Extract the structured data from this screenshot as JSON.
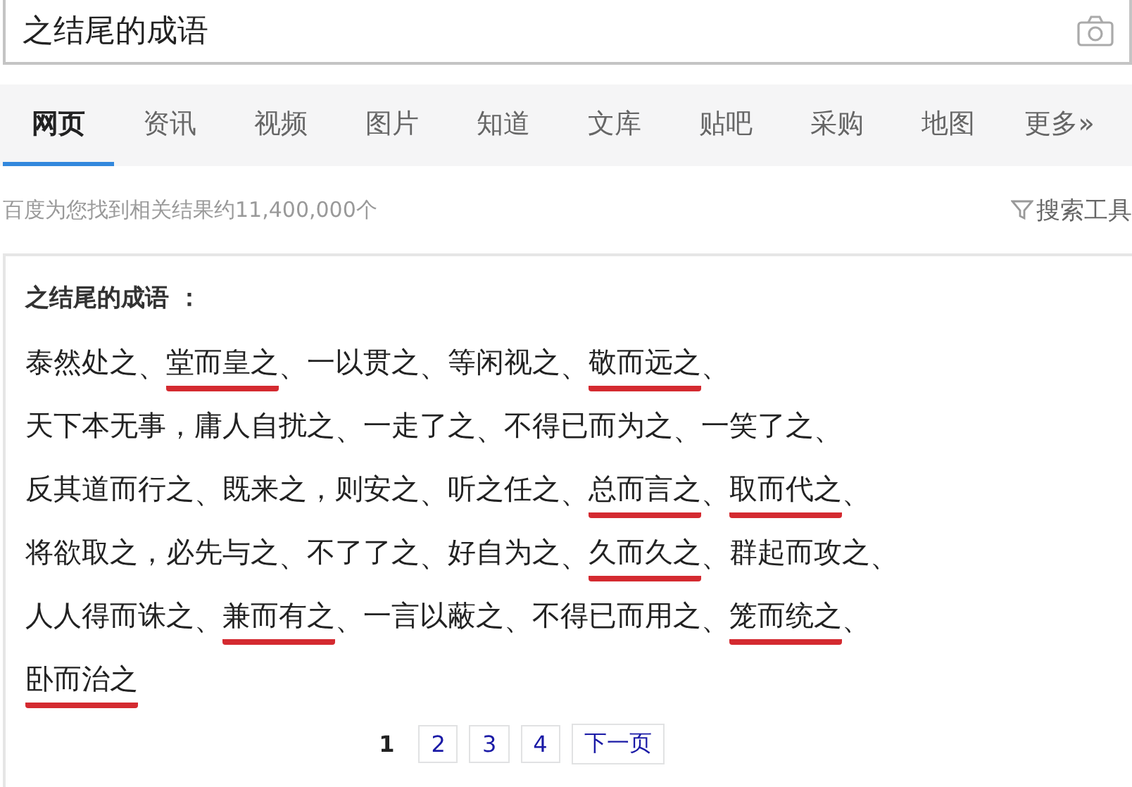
{
  "search": {
    "value": "之结尾的成语"
  },
  "tabs": [
    {
      "label": "网页",
      "selected": true
    },
    {
      "label": "资讯",
      "selected": false
    },
    {
      "label": "视频",
      "selected": false
    },
    {
      "label": "图片",
      "selected": false
    },
    {
      "label": "知道",
      "selected": false
    },
    {
      "label": "文库",
      "selected": false
    },
    {
      "label": "贴吧",
      "selected": false
    },
    {
      "label": "采购",
      "selected": false
    },
    {
      "label": "地图",
      "selected": false
    },
    {
      "label": "更多»",
      "selected": false
    }
  ],
  "result_count": "百度为您找到相关结果约11,400,000个",
  "search_tools": "搜索工具",
  "card": {
    "title": "之结尾的成语 ：",
    "lines": [
      {
        "items": [
          {
            "text": "泰然处之",
            "sep": "、",
            "marked": false
          },
          {
            "text": "堂而皇之",
            "sep": "、",
            "marked": true
          },
          {
            "text": "一以贯之",
            "sep": "、",
            "marked": false
          },
          {
            "text": "等闲视之",
            "sep": "、",
            "marked": false
          },
          {
            "text": "敬而远之",
            "sep": "、",
            "marked": true
          }
        ]
      },
      {
        "items": [
          {
            "text": "天下本无事，庸人自扰之",
            "sep": "、",
            "marked": false
          },
          {
            "text": "一走了之",
            "sep": "、",
            "marked": false
          },
          {
            "text": "不得已而为之",
            "sep": "、",
            "marked": false
          },
          {
            "text": "一笑了之",
            "sep": "、",
            "marked": false
          }
        ]
      },
      {
        "items": [
          {
            "text": "反其道而行之",
            "sep": "、",
            "marked": false
          },
          {
            "text": "既来之，则安之",
            "sep": "、",
            "marked": false
          },
          {
            "text": "听之任之",
            "sep": "、",
            "marked": false
          },
          {
            "text": "总而言之",
            "sep": "、",
            "marked": true
          },
          {
            "text": "取而代之",
            "sep": "、",
            "marked": true
          }
        ]
      },
      {
        "items": [
          {
            "text": "将欲取之，必先与之",
            "sep": "、",
            "marked": false
          },
          {
            "text": "不了了之",
            "sep": "、",
            "marked": false
          },
          {
            "text": "好自为之",
            "sep": "、",
            "marked": false
          },
          {
            "text": "久而久之",
            "sep": "、",
            "marked": true
          },
          {
            "text": "群起而攻之",
            "sep": "、",
            "marked": false
          }
        ]
      },
      {
        "items": [
          {
            "text": "人人得而诛之",
            "sep": "、",
            "marked": false
          },
          {
            "text": "兼而有之",
            "sep": "、",
            "marked": true
          },
          {
            "text": "一言以蔽之",
            "sep": "、",
            "marked": false
          },
          {
            "text": "不得已而用之",
            "sep": "、",
            "marked": false
          },
          {
            "text": "笼而统之",
            "sep": "、",
            "marked": true
          }
        ]
      },
      {
        "items": [
          {
            "text": "卧而治之",
            "marked": true
          }
        ]
      }
    ],
    "pagination": [
      {
        "label": "1",
        "selected": true
      },
      {
        "label": "2",
        "selected": false
      },
      {
        "label": "3",
        "selected": false
      },
      {
        "label": "4",
        "selected": false
      },
      {
        "label": "下一页",
        "selected": false
      }
    ]
  }
}
